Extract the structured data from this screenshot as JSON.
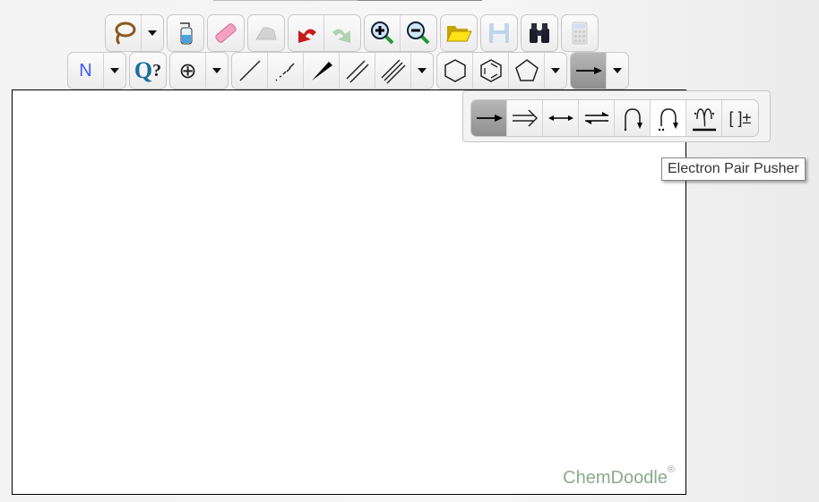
{
  "toolbar_top": {
    "buttons": [
      {
        "name": "lasso",
        "icon": "lasso-icon",
        "has_dropdown": true,
        "enabled": true
      },
      {
        "name": "clear",
        "icon": "wash-bottle-icon",
        "enabled": true
      },
      {
        "name": "erase",
        "icon": "eraser-icon",
        "enabled": true
      },
      {
        "name": "clean",
        "icon": "iron-icon",
        "enabled": false
      },
      {
        "name": "undo",
        "icon": "undo-icon",
        "enabled": true
      },
      {
        "name": "redo",
        "icon": "redo-icon",
        "enabled": false
      },
      {
        "name": "zoom-in",
        "icon": "zoom-in-icon",
        "enabled": true
      },
      {
        "name": "zoom-out",
        "icon": "zoom-out-icon",
        "enabled": true
      },
      {
        "name": "open",
        "icon": "folder-open-icon",
        "enabled": true
      },
      {
        "name": "save",
        "icon": "save-icon",
        "enabled": false
      },
      {
        "name": "search",
        "icon": "binoculars-icon",
        "enabled": true
      },
      {
        "name": "calculate",
        "icon": "calculator-icon",
        "enabled": false
      }
    ]
  },
  "toolbar_bottom": {
    "label_button": "N",
    "query_button": "Q",
    "query_mark": "?",
    "charge_button": "⊕",
    "bonds": [
      "single-bond",
      "recessed-bond",
      "protruding-bond",
      "double-bond",
      "triple-bond"
    ],
    "rings": [
      "cyclohexane",
      "benzene",
      "cyclopentane"
    ],
    "arrow_selected": "synthetic-arrow"
  },
  "arrow_popup": {
    "items": [
      {
        "name": "synthetic-arrow",
        "selected": true
      },
      {
        "name": "retrosynthetic-arrow"
      },
      {
        "name": "resonance-arrow"
      },
      {
        "name": "equilibrium-arrow"
      },
      {
        "name": "electron-pusher-single"
      },
      {
        "name": "electron-pair-pusher",
        "hovered": true
      },
      {
        "name": "electron-bifurcating-pusher"
      },
      {
        "name": "bracket-charge",
        "label": "[ ]±"
      }
    ]
  },
  "tooltip": "Electron Pair Pusher",
  "canvas": {
    "watermark": "ChemDoodle",
    "watermark_mark": "®"
  },
  "colors": {
    "watermark": "#8aab8a",
    "label_atom": "#3b5cff"
  }
}
